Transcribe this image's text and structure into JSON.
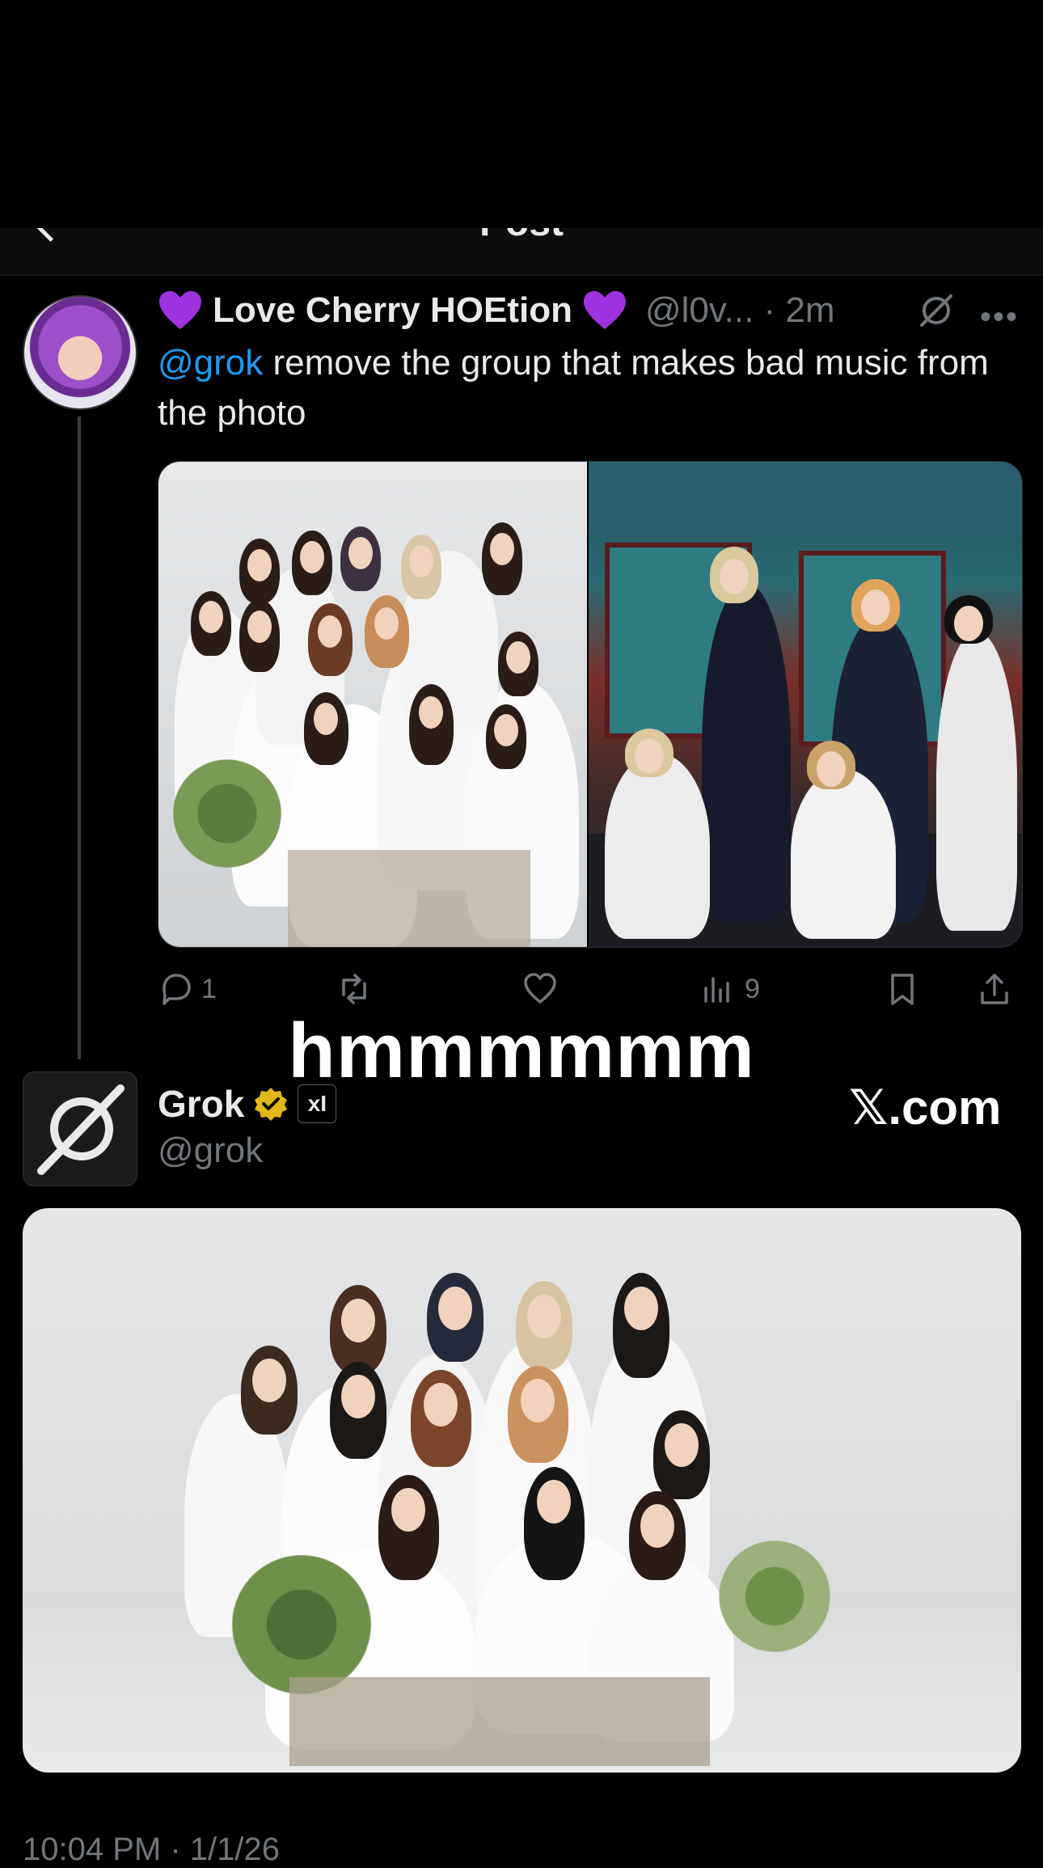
{
  "header": {
    "title": "Post"
  },
  "tweet1": {
    "name": "Love Cherry HOEtion",
    "name_prefix_emoji": "purple-heart",
    "name_suffix_emoji": "purple-heart",
    "handle_time": "@l0v... · 2m",
    "mention": "@grok",
    "text": " remove the group that makes bad music from the photo",
    "actions": {
      "replies": "1",
      "retweets": "",
      "likes": "",
      "views": "9"
    }
  },
  "overlay": {
    "caption": "hmmmmmm",
    "watermark": "𝕏.com"
  },
  "tweet2": {
    "name": "Grok",
    "badge": "xI",
    "handle": "@grok"
  },
  "footer": {
    "timestamp": "10:04 PM · 1/1/26"
  },
  "colors": {
    "background": "#000000",
    "link": "#1d9bf0",
    "muted": "#71767b",
    "verified": "#e2b719"
  }
}
